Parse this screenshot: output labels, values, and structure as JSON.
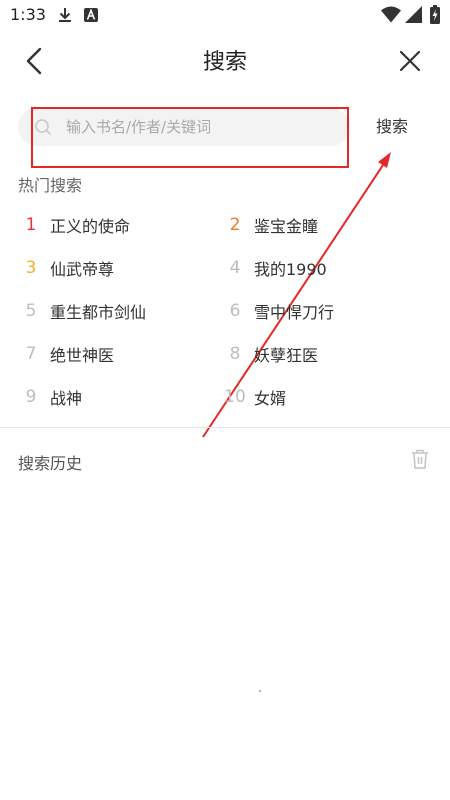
{
  "status_bar": {
    "time": "1:33",
    "icons": [
      "download-icon",
      "app-a-icon",
      "wifi-icon",
      "signal-icon",
      "battery-charging-icon"
    ]
  },
  "header": {
    "title": "搜索",
    "back_icon": "chevron-left-icon",
    "close_icon": "close-icon"
  },
  "search": {
    "placeholder": "输入书名/作者/关键词",
    "value": "",
    "button_label": "搜索",
    "icon": "search-icon"
  },
  "hot_search": {
    "title": "热门搜索",
    "items": [
      {
        "rank": "1",
        "name": "正义的使命",
        "color": "#e8322f"
      },
      {
        "rank": "2",
        "name": "鉴宝金瞳",
        "color": "#f07a2a"
      },
      {
        "rank": "3",
        "name": "仙武帝尊",
        "color": "#f2b21f"
      },
      {
        "rank": "4",
        "name": "我的1990",
        "color": "#bdbdbd"
      },
      {
        "rank": "5",
        "name": "重生都市剑仙",
        "color": "#bdbdbd"
      },
      {
        "rank": "6",
        "name": "雪中悍刀行",
        "color": "#bdbdbd"
      },
      {
        "rank": "7",
        "name": "绝世神医",
        "color": "#bdbdbd"
      },
      {
        "rank": "8",
        "name": "妖孽狂医",
        "color": "#bdbdbd"
      },
      {
        "rank": "9",
        "name": "战神",
        "color": "#bdbdbd"
      },
      {
        "rank": "10",
        "name": "女婿",
        "color": "#bdbdbd"
      }
    ]
  },
  "history": {
    "title": "搜索历史",
    "clear_icon": "trash-icon"
  },
  "colors": {
    "annotation": "#e52727",
    "search_bg": "#f3f3f3"
  }
}
